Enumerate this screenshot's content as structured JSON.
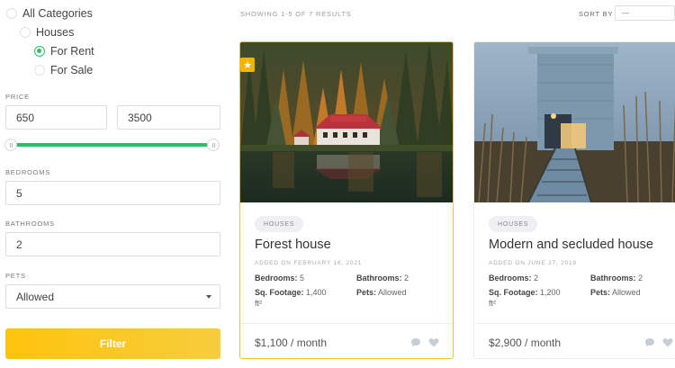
{
  "sidebar": {
    "categories": [
      {
        "label": "All Categories",
        "checked": false
      },
      {
        "label": "Houses",
        "checked": false
      },
      {
        "label": "For Rent",
        "checked": true
      },
      {
        "label": "For Sale",
        "checked": false
      }
    ],
    "price_label": "PRICE",
    "price_min": "650",
    "price_max": "3500",
    "bedrooms_label": "BEDROOMS",
    "bedrooms_value": "5",
    "bathrooms_label": "BATHROOMS",
    "bathrooms_value": "2",
    "pets_label": "PETS",
    "pets_value": "Allowed",
    "filter_button": "Filter",
    "accent_color": "#2bbd6b",
    "button_color": "#fec30d"
  },
  "topbar": {
    "results_text": "SHOWING 1-5 OF 7 RESULTS",
    "sort_label": "SORT BY",
    "sort_value": "—"
  },
  "listings": [
    {
      "featured": true,
      "tag": "HOUSES",
      "title": "Forest house",
      "date": "ADDED ON FEBRUARY 16, 2021",
      "bedrooms_label": "Bedrooms:",
      "bedrooms": "5",
      "bathrooms_label": "Bathrooms:",
      "bathrooms": "2",
      "sqft_label": "Sq. Footage:",
      "sqft": "1,400",
      "sqft_unit": "ft²",
      "pets_label": "Pets:",
      "pets": "Allowed",
      "price": "$1,100 / month"
    },
    {
      "featured": false,
      "tag": "HOUSES",
      "title": "Modern and secluded house",
      "date": "ADDED ON JUNE 17, 2019",
      "bedrooms_label": "Bedrooms:",
      "bedrooms": "2",
      "bathrooms_label": "Bathrooms:",
      "bathrooms": "2",
      "sqft_label": "Sq. Footage:",
      "sqft": "1,200",
      "sqft_unit": "ft²",
      "pets_label": "Pets:",
      "pets": "Allowed",
      "price": "$2,900 / month"
    }
  ]
}
